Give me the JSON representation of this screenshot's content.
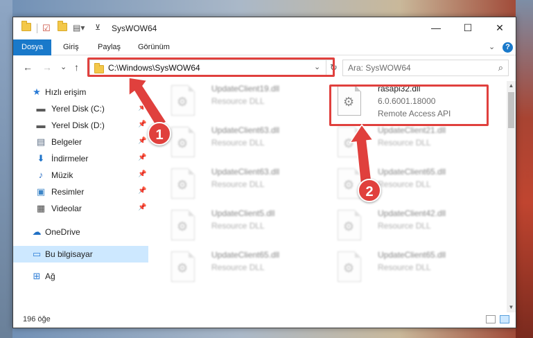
{
  "window": {
    "title": "SysWOW64",
    "controls": {
      "minimize": "—",
      "maximize": "☐",
      "close": "✕"
    }
  },
  "ribbon": {
    "tabs": [
      {
        "label": "Dosya",
        "active": true
      },
      {
        "label": "Giriş",
        "active": false
      },
      {
        "label": "Paylaş",
        "active": false
      },
      {
        "label": "Görünüm",
        "active": false
      }
    ],
    "expand": "⌄",
    "help": "?"
  },
  "nav": {
    "back": "←",
    "forward": "→",
    "recent": "⌄",
    "up": "↑",
    "address": "C:\\Windows\\SysWOW64",
    "address_chevron": "⌄",
    "refresh": "↻",
    "search_placeholder": "Ara: SysWOW64",
    "search_icon": "⌕"
  },
  "sidebar": {
    "items": [
      {
        "label": "Hızlı erişim",
        "icon": "star-icon",
        "glyph": "★",
        "color": "#2a7bd6",
        "pinned": false
      },
      {
        "label": "Yerel Disk (C:)",
        "icon": "drive-icon",
        "glyph": "▬",
        "color": "#5a5a5a",
        "pinned": true
      },
      {
        "label": "Yerel Disk (D:)",
        "icon": "drive-icon",
        "glyph": "▬",
        "color": "#5a5a5a",
        "pinned": true
      },
      {
        "label": "Belgeler",
        "icon": "document-icon",
        "glyph": "▤",
        "color": "#5f6f86",
        "pinned": true
      },
      {
        "label": "İndirmeler",
        "icon": "download-icon",
        "glyph": "⬇",
        "color": "#1d73c9",
        "pinned": true
      },
      {
        "label": "Müzik",
        "icon": "music-icon",
        "glyph": "♪",
        "color": "#2a6fc4",
        "pinned": true
      },
      {
        "label": "Resimler",
        "icon": "pictures-icon",
        "glyph": "▣",
        "color": "#3e86c7",
        "pinned": true
      },
      {
        "label": "Videolar",
        "icon": "video-icon",
        "glyph": "▦",
        "color": "#4a4a4a",
        "pinned": true
      },
      {
        "label": "OneDrive",
        "icon": "cloud-icon",
        "glyph": "☁",
        "color": "#1f6fc4",
        "pinned": false
      },
      {
        "label": "Bu bilgisayar",
        "icon": "computer-icon",
        "glyph": "▭",
        "color": "#2a7bd6",
        "pinned": false,
        "selected": true
      },
      {
        "label": "Ağ",
        "icon": "network-icon",
        "glyph": "⊞",
        "color": "#2a7bd6",
        "pinned": false
      }
    ],
    "pin_glyph": "📌"
  },
  "files": {
    "left_column": [
      {
        "name": "UpdateClient19.dll",
        "type": "Resource DLL"
      },
      {
        "name": "UpdateClient63.dll",
        "type": "Resource DLL"
      },
      {
        "name": "UpdateClient63.dll",
        "type": "Resource DLL"
      },
      {
        "name": "UpdateClient5.dll",
        "type": "Resource DLL"
      },
      {
        "name": "UpdateClient65.dll",
        "type": "Resource DLL"
      }
    ],
    "right_column": [
      {
        "name": "rasapi32.dll",
        "version": "6.0.6001.18000",
        "type": "Remote Access API",
        "highlighted": true
      },
      {
        "name": "UpdateClient21.dll",
        "type": "Resource DLL"
      },
      {
        "name": "UpdateClient65.dll",
        "type": "Resource DLL"
      },
      {
        "name": "UpdateClient42.dll",
        "type": "Resource DLL"
      },
      {
        "name": "UpdateClient65.dll",
        "type": "Resource DLL"
      }
    ]
  },
  "statusbar": {
    "count": "196 öğe"
  },
  "annotations": {
    "step1": "1",
    "step2": "2",
    "color": "#e0403d"
  }
}
